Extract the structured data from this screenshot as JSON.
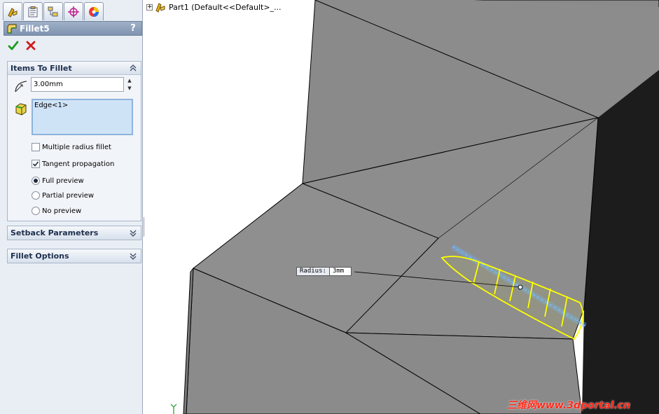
{
  "property_manager": {
    "tabs": [
      {
        "icon": "feature-manager-icon"
      },
      {
        "icon": "property-manager-icon"
      },
      {
        "icon": "configuration-manager-icon"
      },
      {
        "icon": "dimxpert-manager-icon"
      },
      {
        "icon": "display-manager-icon"
      }
    ],
    "title": "Fillet5",
    "help": "?",
    "items_group": {
      "title": "Items To Fillet",
      "radius_value": "3.00mm",
      "edge_list": [
        "Edge<1>"
      ],
      "multiple_radius_label": "Multiple radius fillet",
      "multiple_radius_checked": false,
      "tangent_label": "Tangent propagation",
      "tangent_checked": true,
      "preview_options": [
        {
          "label": "Full preview",
          "selected": true
        },
        {
          "label": "Partial preview",
          "selected": false
        },
        {
          "label": "No preview",
          "selected": false
        }
      ]
    },
    "setback_group": {
      "title": "Setback Parameters"
    },
    "options_group": {
      "title": "Fillet Options"
    }
  },
  "viewport": {
    "tree_label": "Part1  (Default<<Default>_...",
    "radius_callout": {
      "key": "Radius:",
      "value": "3mm"
    },
    "watermark": "三维网www.3dportal.cn"
  },
  "colors": {
    "accent": "#7f93b0",
    "ok": "#1f9a1f",
    "cancel": "#d11a1a",
    "fillet_preview": "#ffff00",
    "edge_highlight": "#6fb8ff"
  }
}
